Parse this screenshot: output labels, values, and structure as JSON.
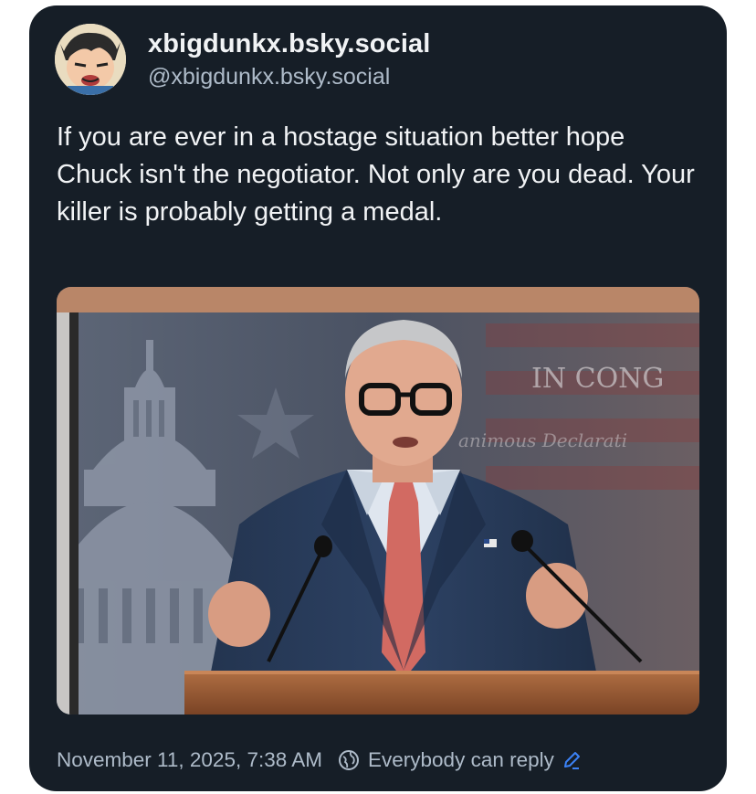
{
  "post": {
    "author": {
      "display_name": "xbigdunkx.bsky.social",
      "handle": "@xbigdunkx.bsky.social",
      "avatar_icon": "cartoon-avatar-icon"
    },
    "text": "If you are ever in a hostage situation better hope Chuck isn't the negotiator. Not only are you dead. Your killer is probably getting a medal.",
    "image": {
      "backdrop_text": "IN CONG",
      "backdrop_text_2": "animous Declarati"
    },
    "footer": {
      "timestamp": "November 11, 2025, 7:38 AM",
      "reply_setting": "Everybody can reply",
      "globe_icon": "globe-icon",
      "edit_icon": "pencil-icon"
    }
  },
  "colors": {
    "card_background": "#161e27",
    "primary_text": "#f1f3f5",
    "secondary_text": "#aebbc9",
    "accent": "#3b82f6"
  }
}
